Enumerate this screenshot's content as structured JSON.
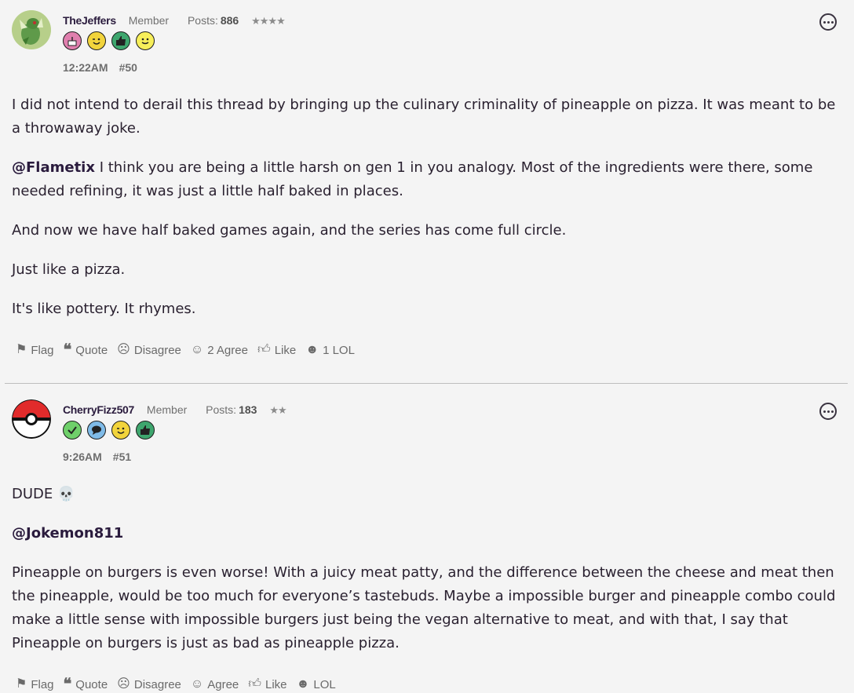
{
  "posts": [
    {
      "username": "TheJeffers",
      "role": "Member",
      "posts_label": "Posts:",
      "posts_count": "886",
      "stars": "★★★★",
      "time": "12:22AM",
      "post_number": "#50",
      "badges": [
        "cake-badge",
        "wink-badge",
        "thumbs-up-badge",
        "smile-badge"
      ],
      "paragraphs": [
        {
          "mention": "",
          "text": "I did not intend to derail this thread by bringing up the culinary criminality of pineapple on pizza. It was meant to be a throwaway joke."
        },
        {
          "mention": "@Flametix",
          "text": " I think you are being a little harsh on gen 1 in you analogy. Most of the ingredients were there, some needed refining, it was just a little half baked in places."
        },
        {
          "mention": "",
          "text": "And now we have half baked games again, and the series has come full circle."
        },
        {
          "mention": "",
          "text": "Just like a pizza."
        },
        {
          "mention": "",
          "text": "It's like pottery. It rhymes."
        }
      ],
      "actions": {
        "flag": "Flag",
        "quote": "Quote",
        "disagree": "Disagree",
        "agree": "2 Agree",
        "like": "Like",
        "lol": "1 LOL"
      }
    },
    {
      "username": "CherryFizz507",
      "role": "Member",
      "posts_label": "Posts:",
      "posts_count": "183",
      "stars": "★★",
      "time": "9:26AM",
      "post_number": "#51",
      "badges": [
        "check-badge",
        "speech-badge",
        "wink-badge",
        "thumbs-up-badge"
      ],
      "paragraphs": [
        {
          "mention": "",
          "text": "DUDE 💀"
        },
        {
          "mention": "@Jokemon811",
          "text": ""
        },
        {
          "mention": "",
          "text": "Pineapple on burgers is even worse! With a juicy meat patty, and the difference between the cheese and meat then the pineapple, would be too much for everyone’s tastebuds. Maybe a impossible burger and pineapple combo could make a little sense with impossible burgers just being the vegan alternative to meat, and with that, I say that Pineapple on burgers is just as bad as pineapple pizza."
        }
      ],
      "actions": {
        "flag": "Flag",
        "quote": "Quote",
        "disagree": "Disagree",
        "agree": "Agree",
        "like": "Like",
        "lol": "LOL"
      }
    }
  ],
  "colors": {
    "background": "#f4f4f4",
    "text": "#2a2130",
    "muted": "#6a6a6a"
  }
}
